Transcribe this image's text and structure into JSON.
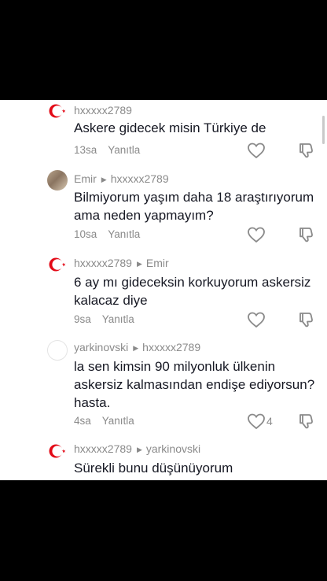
{
  "comments": [
    {
      "username": "hxxxxx2789",
      "reply_to": "",
      "text": "Askere gidecek misin Türkiye de",
      "time": "13sa",
      "reply_label": "Yanıtla",
      "likes": ""
    },
    {
      "username": "Emir",
      "reply_to": "hxxxxx2789",
      "text": "Bilmiyorum yaşım daha 18 araştırıyorum ama neden yapmayım?",
      "time": "10sa",
      "reply_label": "Yanıtla",
      "likes": ""
    },
    {
      "username": "hxxxxx2789",
      "reply_to": "Emir",
      "text": "6 ay mı gideceksin korkuyorum askersiz kalacaz diye",
      "time": "9sa",
      "reply_label": "Yanıtla",
      "likes": ""
    },
    {
      "username": "yarkinovski",
      "reply_to": "hxxxxx2789",
      "text": "la sen kimsin 90 milyonluk ülkenin askersiz kalmasından endişe ediyorsun? hasta.",
      "time": "4sa",
      "reply_label": "Yanıtla",
      "likes": "4"
    },
    {
      "username": "hxxxxx2789",
      "reply_to": "yarkinovski",
      "text": "Sürekli bunu düşünüyorum",
      "time": "",
      "reply_label": "",
      "likes": ""
    }
  ],
  "colors": {
    "flag_red": "#e30a17",
    "text": "#161823",
    "muted": "#8a8a8a"
  },
  "icons": [
    "turkish-flag-avatar",
    "heart-icon",
    "dislike-icon",
    "reply-arrow-icon"
  ]
}
